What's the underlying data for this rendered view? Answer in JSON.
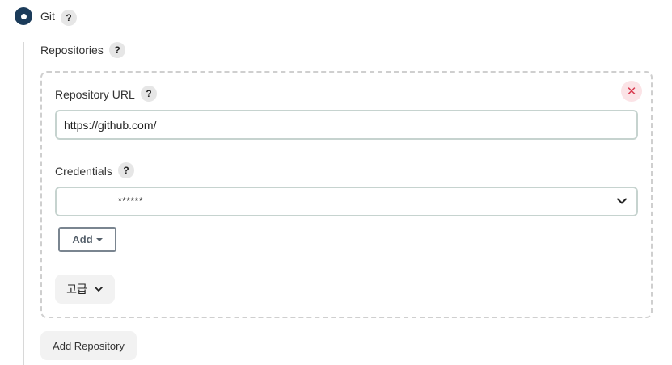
{
  "scm": {
    "selected_label": "Git",
    "help": "?"
  },
  "repositories": {
    "label": "Repositories",
    "help": "?",
    "items": [
      {
        "url_label": "Repository URL",
        "url_help": "?",
        "url_value": "https://github.com/",
        "delete_glyph": "✕",
        "credentials_label": "Credentials",
        "credentials_help": "?",
        "credentials_value": "******",
        "add_label": "Add",
        "advanced_label": "고급"
      }
    ],
    "add_repository_label": "Add Repository"
  },
  "colors": {
    "radio_fill": "#1b3b5a",
    "delete_bg": "#fbe3e6",
    "delete_fg": "#d83a4f",
    "input_border": "#c6d3cf"
  }
}
